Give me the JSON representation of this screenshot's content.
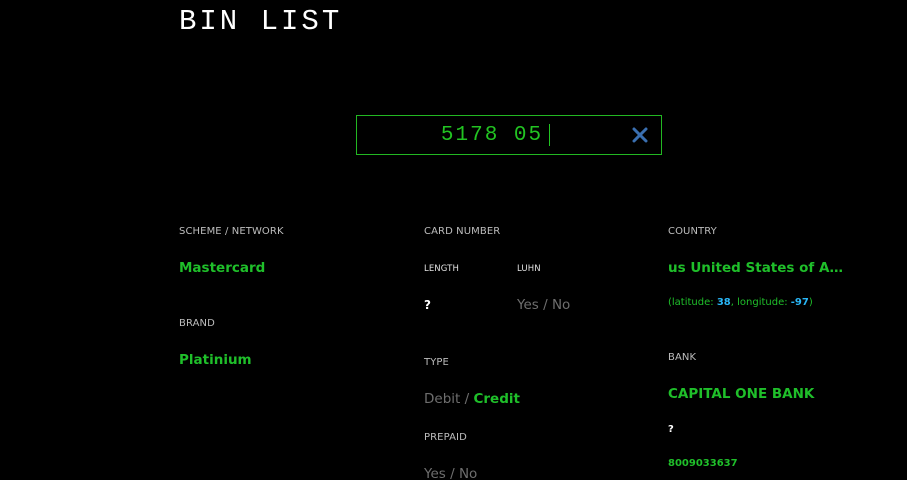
{
  "app": {
    "title": "BIN LIST"
  },
  "search": {
    "value": "5178 05",
    "clear_icon": "close-icon",
    "clear_color": "#3a6fb0"
  },
  "scheme": {
    "label": "SCHEME / NETWORK",
    "value": "Mastercard"
  },
  "brand": {
    "label": "BRAND",
    "value": "Platinium"
  },
  "card_number": {
    "label": "CARD NUMBER",
    "length_label": "LENGTH",
    "length_value": "?",
    "luhn_label": "LUHN",
    "luhn_yes": "Yes",
    "luhn_sep": " / ",
    "luhn_no": "No"
  },
  "type": {
    "label": "TYPE",
    "debit": "Debit",
    "sep": " / ",
    "credit": "Credit",
    "selected": "Credit"
  },
  "prepaid": {
    "label": "PREPAID",
    "yes": "Yes",
    "sep": " / ",
    "no": "No"
  },
  "country": {
    "label": "COUNTRY",
    "value": "us United States of Ameri...",
    "lat_label": "(latitude: ",
    "lat_value": "38",
    "lon_label": ", longitude: ",
    "lon_value": "-97",
    "close_paren": ")"
  },
  "bank": {
    "label": "BANK",
    "name": "CAPITAL ONE BANK",
    "url": "?",
    "phone": "8009033637"
  },
  "colors": {
    "background": "#000000",
    "accent_green": "#1fbf2a",
    "muted_grey": "#6e6e6e",
    "coordinate_blue": "#29b6f6"
  }
}
